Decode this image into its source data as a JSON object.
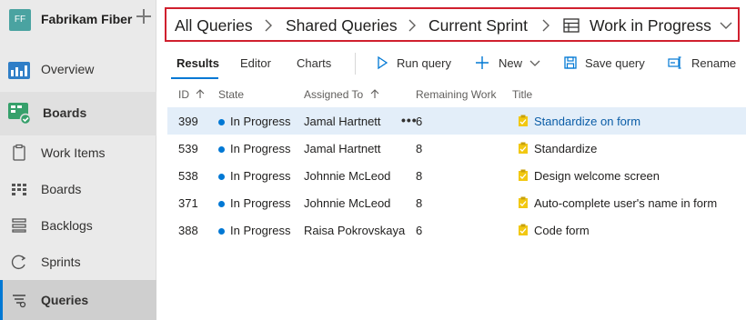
{
  "project": {
    "initials": "FF",
    "name": "Fabrikam Fiber"
  },
  "nav": {
    "overview": "Overview",
    "boards_section": "Boards",
    "items": [
      {
        "label": "Work Items",
        "icon": "work-items-icon"
      },
      {
        "label": "Boards",
        "icon": "board-icon"
      },
      {
        "label": "Backlogs",
        "icon": "backlog-icon"
      },
      {
        "label": "Sprints",
        "icon": "sprint-icon"
      },
      {
        "label": "Queries",
        "icon": "query-icon",
        "selected": true
      }
    ]
  },
  "breadcrumb": {
    "items": [
      "All Queries",
      "Shared Queries",
      "Current Sprint",
      "Work in Progress"
    ]
  },
  "toolbar": {
    "tabs": [
      "Results",
      "Editor",
      "Charts"
    ],
    "active_tab": "Results",
    "run_query": "Run query",
    "new": "New",
    "save_query": "Save query",
    "rename": "Rename"
  },
  "table": {
    "columns": {
      "id": "ID",
      "state": "State",
      "assigned_to": "Assigned To",
      "remaining_work": "Remaining Work",
      "title": "Title"
    },
    "rows": [
      {
        "id": "399",
        "state": "In Progress",
        "assigned_to": "Jamal Hartnett",
        "remaining_work": "6",
        "title": "Standardize on form",
        "selected": true
      },
      {
        "id": "539",
        "state": "In Progress",
        "assigned_to": "Jamal Hartnett",
        "remaining_work": "8",
        "title": "Standardize"
      },
      {
        "id": "538",
        "state": "In Progress",
        "assigned_to": "Johnnie McLeod",
        "remaining_work": "8",
        "title": "Design welcome screen"
      },
      {
        "id": "371",
        "state": "In Progress",
        "assigned_to": "Johnnie McLeod",
        "remaining_work": "8",
        "title": "Auto-complete user's name in form"
      },
      {
        "id": "388",
        "state": "In Progress",
        "assigned_to": "Raisa Pokrovskaya",
        "remaining_work": "6",
        "title": "Code form"
      }
    ]
  },
  "colors": {
    "accent": "#0078d4",
    "highlight_border": "#d0202e",
    "in_progress_dot": "#0078d4",
    "task_icon": "#f2c811"
  }
}
